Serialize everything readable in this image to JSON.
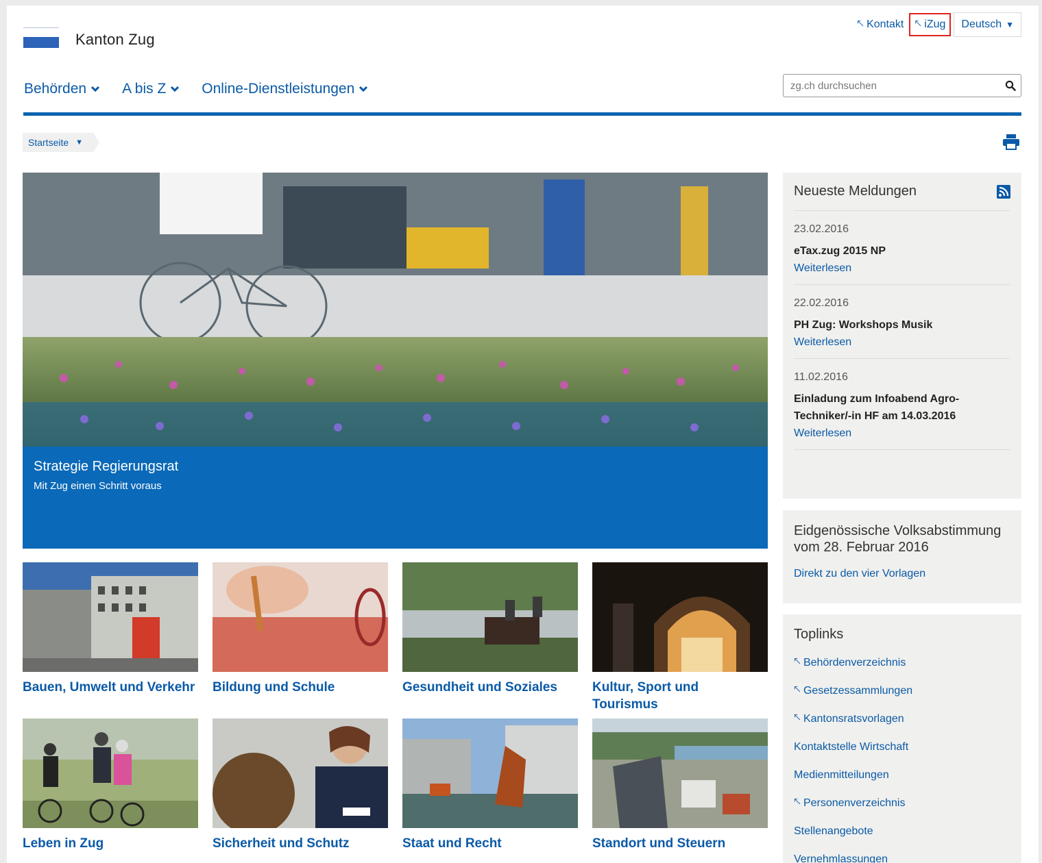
{
  "header": {
    "logo_text": "Kanton Zug",
    "toplinks": {
      "kontakt": "Kontakt",
      "izug": "iZug"
    },
    "language": "Deutsch",
    "search_placeholder": "zg.ch durchsuchen",
    "nav": [
      "Behörden",
      "A bis Z",
      "Online-Dienstleistungen"
    ]
  },
  "breadcrumb": {
    "label": "Startseite"
  },
  "hero": {
    "title": "Strategie Regierungsrat",
    "subtitle": "Mit Zug einen Schritt voraus"
  },
  "tiles": [
    {
      "label": "Bauen, Umwelt und Verkehr"
    },
    {
      "label": "Bildung und Schule"
    },
    {
      "label": "Gesundheit und Soziales"
    },
    {
      "label": "Kultur, Sport und Tourismus"
    },
    {
      "label": "Leben in Zug"
    },
    {
      "label": "Sicherheit und Schutz"
    },
    {
      "label": "Staat und Recht"
    },
    {
      "label": "Standort und Steuern"
    }
  ],
  "news": {
    "title": "Neueste Meldungen",
    "items": [
      {
        "date": "23.02.2016",
        "headline": "eTax.zug 2015 NP",
        "more": "Weiterlesen"
      },
      {
        "date": "22.02.2016",
        "headline": "PH Zug: Workshops Musik",
        "more": "Weiterlesen"
      },
      {
        "date": "11.02.2016",
        "headline": "Einladung zum Infoabend Agro-Techniker/-in HF am 14.03.2016",
        "more": "Weiterlesen"
      }
    ]
  },
  "vote": {
    "title": "Eidgenössische Volksabstimmung vom 28. Februar 2016",
    "link": "Direkt zu den vier Vorlagen"
  },
  "toplinks_box": {
    "title": "Toplinks",
    "links": [
      {
        "label": "Behördenverzeichnis",
        "icon": "external-arrow-icon"
      },
      {
        "label": "Gesetzessammlungen",
        "icon": "external-arrow-icon"
      },
      {
        "label": "Kantonsratsvorlagen",
        "icon": "external-arrow-icon"
      },
      {
        "label": "Kontaktstelle Wirtschaft",
        "icon": ""
      },
      {
        "label": "Medienmitteilungen",
        "icon": ""
      },
      {
        "label": "Personenverzeichnis",
        "icon": "external-arrow-icon"
      },
      {
        "label": "Stellenangebote",
        "icon": ""
      },
      {
        "label": "Vernehmlassungen",
        "icon": ""
      }
    ]
  },
  "colors": {
    "brand_blue": "#0a63b0",
    "link_blue": "#0a5aa7",
    "highlight_red": "#e0231c",
    "box_bg": "#f0f0ee"
  }
}
